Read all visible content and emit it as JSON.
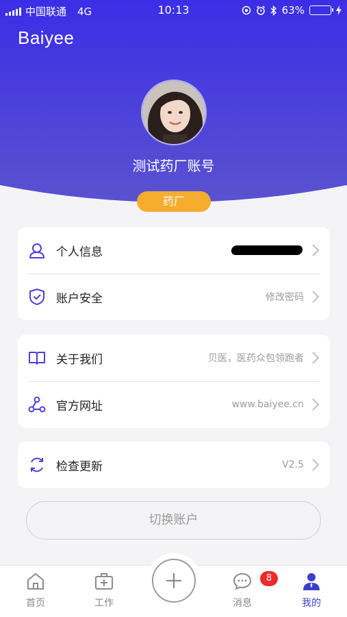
{
  "status_bar": {
    "carrier": "中国联通",
    "network": "4G",
    "time": "10:13",
    "battery": "63%",
    "battery_level": 0.63
  },
  "brand": "Baiyee",
  "profile": {
    "username": "测试药厂账号",
    "role": "药厂"
  },
  "group_account": [
    {
      "label": "个人信息",
      "value": "",
      "icon": "user-icon"
    },
    {
      "label": "账户安全",
      "value": "修改密码",
      "icon": "shield-check-icon"
    }
  ],
  "group_about": [
    {
      "label": "关于我们",
      "value": "贝医，医药众包领跑者",
      "icon": "book-icon"
    },
    {
      "label": "官方网址",
      "value": "www.baiyee.cn",
      "icon": "share-nodes-icon"
    }
  ],
  "group_update": [
    {
      "label": "检查更新",
      "value": "V2.5",
      "icon": "refresh-icon"
    }
  ],
  "switch_account": "切换账户",
  "tabbar": {
    "home": "首页",
    "work": "工作",
    "messages": "消息",
    "messages_badge": "8",
    "mine": "我的"
  },
  "colors": {
    "header_top": "#3b2ee6",
    "header_bottom": "#5a52cf",
    "accent": "#3d3fcb",
    "role_badge": "#f5ac2f",
    "badge_red": "#ec2b2b"
  }
}
